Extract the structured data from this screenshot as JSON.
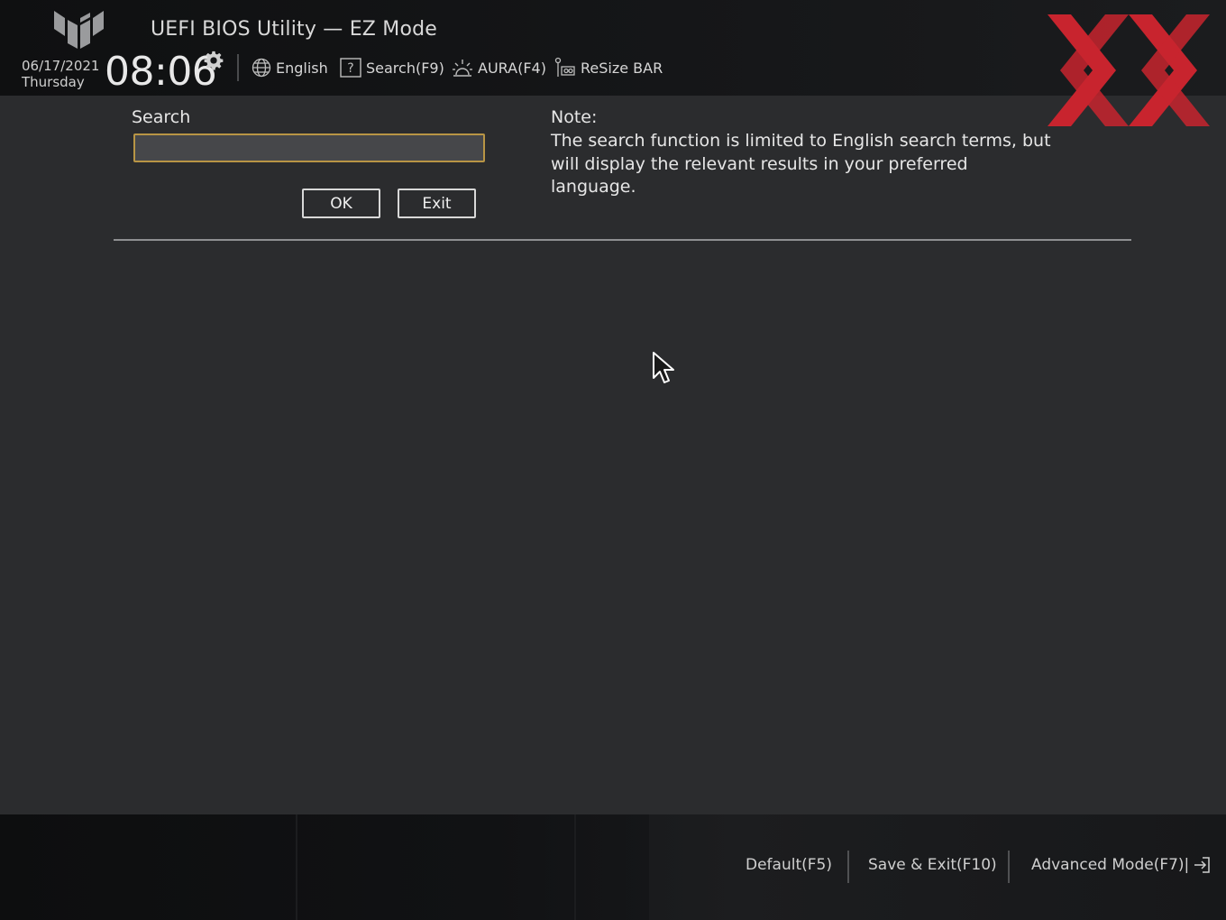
{
  "header": {
    "title": "UEFI BIOS Utility — EZ Mode",
    "date": "06/17/2021",
    "weekday": "Thursday",
    "time": "08:06",
    "items": [
      {
        "label": "English",
        "icon": "globe-icon"
      },
      {
        "label": "Search(F9)",
        "icon": "question-icon"
      },
      {
        "label": "AURA(F4)",
        "icon": "aura-icon"
      },
      {
        "label": "ReSize BAR",
        "icon": "resize-bar-icon"
      }
    ]
  },
  "search": {
    "label": "Search",
    "value": "",
    "placeholder": "",
    "ok_label": "OK",
    "exit_label": "Exit"
  },
  "note": {
    "title": "Note:",
    "text": "The search function is limited to English search terms, but will display the relevant results in your preferred language."
  },
  "footer": {
    "default_label": "Default(F5)",
    "save_exit_label": "Save & Exit(F10)",
    "advanced_label": "Advanced Mode(F7)|"
  },
  "colors": {
    "background": "#2b2c2e",
    "header": "#141517",
    "input_border": "#b89545",
    "brand_red": "#c8242e"
  }
}
